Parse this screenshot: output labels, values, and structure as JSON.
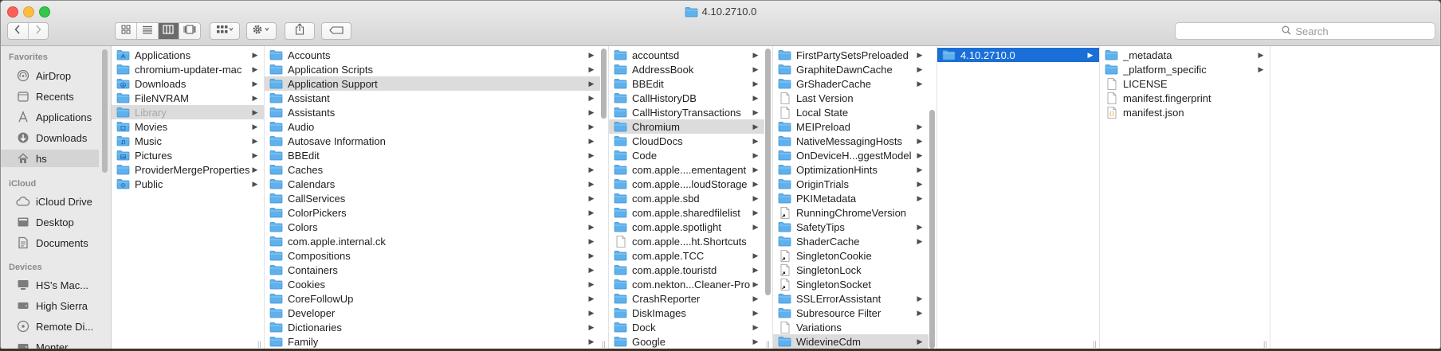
{
  "window": {
    "title": "4.10.2710.0"
  },
  "toolbar": {
    "back_icon": "chevron-left-icon",
    "forward_icon": "chevron-right-icon",
    "view_modes": [
      "icon-view",
      "list-view",
      "column-view",
      "gallery-view"
    ],
    "active_view": "column-view",
    "group_icon": "grid-group-icon",
    "action_icon": "gear-icon",
    "share_icon": "share-icon",
    "tag_icon": "tag-icon",
    "search_placeholder": "Search"
  },
  "sidebar": {
    "favorites_header": "Favorites",
    "favorites": [
      {
        "label": "AirDrop",
        "icon": "airdrop-icon"
      },
      {
        "label": "Recents",
        "icon": "clock-icon"
      },
      {
        "label": "Applications",
        "icon": "applications-icon"
      },
      {
        "label": "Downloads",
        "icon": "downloads-icon"
      },
      {
        "label": "hs",
        "icon": "home-icon"
      }
    ],
    "icloud_header": "iCloud",
    "icloud": [
      {
        "label": "iCloud Drive",
        "icon": "cloud-icon"
      },
      {
        "label": "Desktop",
        "icon": "desktop-icon"
      },
      {
        "label": "Documents",
        "icon": "documents-icon"
      }
    ],
    "devices_header": "Devices",
    "devices": [
      {
        "label": "HS's Mac...",
        "icon": "computer-icon"
      },
      {
        "label": "High Sierra",
        "icon": "disk-icon"
      },
      {
        "label": "Remote Di...",
        "icon": "remote-disc-icon"
      },
      {
        "label": "Monter...",
        "icon": "disk-icon"
      }
    ]
  },
  "columns": [
    {
      "items": [
        {
          "name": "Applications",
          "type": "folder-app"
        },
        {
          "name": "chromium-updater-mac",
          "type": "folder"
        },
        {
          "name": "Downloads",
          "type": "folder-download"
        },
        {
          "name": "FileNVRAM",
          "type": "folder"
        },
        {
          "name": "Library",
          "type": "folder",
          "state": "selected-dim"
        },
        {
          "name": "Movies",
          "type": "folder-movie"
        },
        {
          "name": "Music",
          "type": "folder-music"
        },
        {
          "name": "Pictures",
          "type": "folder-picture"
        },
        {
          "name": "ProviderMergeProperties",
          "type": "folder"
        },
        {
          "name": "Public",
          "type": "folder-public"
        }
      ]
    },
    {
      "items": [
        {
          "name": "Accounts",
          "type": "folder"
        },
        {
          "name": "Application Scripts",
          "type": "folder"
        },
        {
          "name": "Application Support",
          "type": "folder",
          "state": "selected"
        },
        {
          "name": "Assistant",
          "type": "folder"
        },
        {
          "name": "Assistants",
          "type": "folder"
        },
        {
          "name": "Audio",
          "type": "folder"
        },
        {
          "name": "Autosave Information",
          "type": "folder"
        },
        {
          "name": "BBEdit",
          "type": "folder"
        },
        {
          "name": "Caches",
          "type": "folder"
        },
        {
          "name": "Calendars",
          "type": "folder"
        },
        {
          "name": "CallServices",
          "type": "folder"
        },
        {
          "name": "ColorPickers",
          "type": "folder"
        },
        {
          "name": "Colors",
          "type": "folder"
        },
        {
          "name": "com.apple.internal.ck",
          "type": "folder"
        },
        {
          "name": "Compositions",
          "type": "folder"
        },
        {
          "name": "Containers",
          "type": "folder"
        },
        {
          "name": "Cookies",
          "type": "folder"
        },
        {
          "name": "CoreFollowUp",
          "type": "folder"
        },
        {
          "name": "Developer",
          "type": "folder"
        },
        {
          "name": "Dictionaries",
          "type": "folder"
        },
        {
          "name": "Family",
          "type": "folder"
        }
      ]
    },
    {
      "items": [
        {
          "name": "accountsd",
          "type": "folder"
        },
        {
          "name": "AddressBook",
          "type": "folder"
        },
        {
          "name": "BBEdit",
          "type": "folder"
        },
        {
          "name": "CallHistoryDB",
          "type": "folder"
        },
        {
          "name": "CallHistoryTransactions",
          "type": "folder"
        },
        {
          "name": "Chromium",
          "type": "folder",
          "state": "selected"
        },
        {
          "name": "CloudDocs",
          "type": "folder"
        },
        {
          "name": "Code",
          "type": "folder"
        },
        {
          "name": "com.apple....ementagent",
          "type": "folder"
        },
        {
          "name": "com.apple....loudStorage",
          "type": "folder"
        },
        {
          "name": "com.apple.sbd",
          "type": "folder"
        },
        {
          "name": "com.apple.sharedfilelist",
          "type": "folder"
        },
        {
          "name": "com.apple.spotlight",
          "type": "folder"
        },
        {
          "name": "com.apple....ht.Shortcuts",
          "type": "file"
        },
        {
          "name": "com.apple.TCC",
          "type": "folder"
        },
        {
          "name": "com.apple.touristd",
          "type": "folder"
        },
        {
          "name": "com.nekton...Cleaner-Pro",
          "type": "folder"
        },
        {
          "name": "CrashReporter",
          "type": "folder"
        },
        {
          "name": "DiskImages",
          "type": "folder"
        },
        {
          "name": "Dock",
          "type": "folder"
        },
        {
          "name": "Google",
          "type": "folder"
        }
      ]
    },
    {
      "items": [
        {
          "name": "FirstPartySetsPreloaded",
          "type": "folder"
        },
        {
          "name": "GraphiteDawnCache",
          "type": "folder"
        },
        {
          "name": "GrShaderCache",
          "type": "folder"
        },
        {
          "name": "Last Version",
          "type": "file"
        },
        {
          "name": "Local State",
          "type": "file"
        },
        {
          "name": "MEIPreload",
          "type": "folder"
        },
        {
          "name": "NativeMessagingHosts",
          "type": "folder"
        },
        {
          "name": "OnDeviceH...ggestModel",
          "type": "folder"
        },
        {
          "name": "OptimizationHints",
          "type": "folder"
        },
        {
          "name": "OriginTrials",
          "type": "folder"
        },
        {
          "name": "PKIMetadata",
          "type": "folder"
        },
        {
          "name": "RunningChromeVersion",
          "type": "alias"
        },
        {
          "name": "SafetyTips",
          "type": "folder"
        },
        {
          "name": "ShaderCache",
          "type": "folder"
        },
        {
          "name": "SingletonCookie",
          "type": "alias"
        },
        {
          "name": "SingletonLock",
          "type": "alias"
        },
        {
          "name": "SingletonSocket",
          "type": "alias"
        },
        {
          "name": "SSLErrorAssistant",
          "type": "folder"
        },
        {
          "name": "Subresource Filter",
          "type": "folder"
        },
        {
          "name": "Variations",
          "type": "file"
        },
        {
          "name": "WidevineCdm",
          "type": "folder",
          "state": "selected"
        }
      ]
    },
    {
      "items": [
        {
          "name": "4.10.2710.0",
          "type": "folder",
          "state": "active"
        }
      ]
    },
    {
      "items": [
        {
          "name": "_metadata",
          "type": "folder"
        },
        {
          "name": "_platform_specific",
          "type": "folder"
        },
        {
          "name": "LICENSE",
          "type": "file"
        },
        {
          "name": "manifest.fingerprint",
          "type": "file"
        },
        {
          "name": "manifest.json",
          "type": "json"
        }
      ]
    }
  ]
}
